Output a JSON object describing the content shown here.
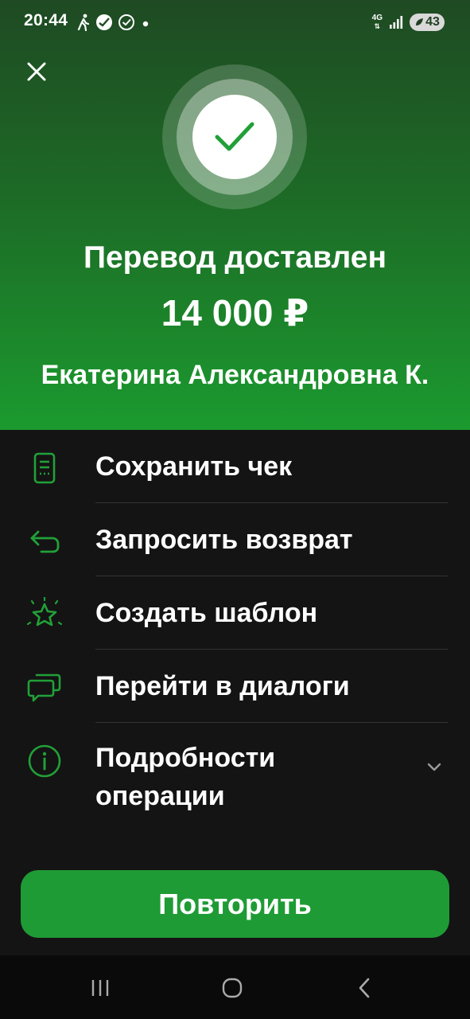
{
  "status_bar": {
    "time": "20:44",
    "network": "4G",
    "battery": "43",
    "left_icons": [
      "walking-icon",
      "sber-icon",
      "check-circle-icon",
      "notification-dot-icon"
    ]
  },
  "hero": {
    "title": "Перевод доставлен",
    "amount": "14 000 ₽",
    "recipient": "Екатерина Александровна К."
  },
  "actions": [
    {
      "label": "Сохранить чек",
      "icon": "receipt-icon"
    },
    {
      "label": "Запросить возврат",
      "icon": "return-arrow-icon"
    },
    {
      "label": "Создать шаблон",
      "icon": "star-icon"
    },
    {
      "label": "Перейти в диалоги",
      "icon": "chat-icon"
    },
    {
      "label": "Подробности операции",
      "icon": "info-icon"
    }
  ],
  "primary_button": {
    "label": "Повторить"
  },
  "colors": {
    "accent": "#21a038",
    "button": "#1f9b35",
    "background": "#141414",
    "hero_top": "#1f4a23",
    "hero_bottom": "#1b9a2f"
  }
}
